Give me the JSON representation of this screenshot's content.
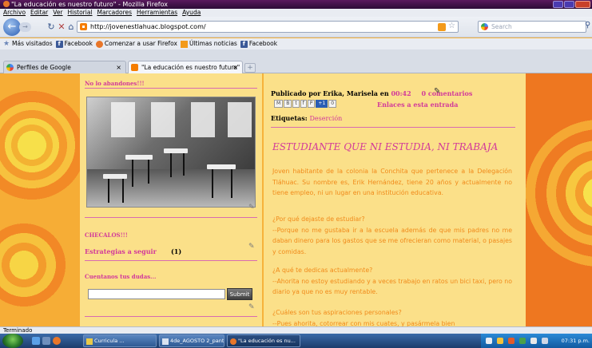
{
  "window": {
    "title": "\"La educación es nuestro futuro\" - Mozilla Firefox"
  },
  "menu": [
    "Archivo",
    "Editar",
    "Ver",
    "Historial",
    "Marcadores",
    "Herramientas",
    "Ayuda"
  ],
  "nav": {
    "url": "http://jovenestlahuac.blogspot.com/",
    "search_placeholder": "Search"
  },
  "bookmarks": [
    {
      "label": "Más visitados",
      "icon": "star-icon"
    },
    {
      "label": "Facebook",
      "icon": "facebook-icon"
    },
    {
      "label": "Comenzar a usar Firefox",
      "icon": "firefox-icon"
    },
    {
      "label": "Últimas noticias",
      "icon": "rss-icon"
    },
    {
      "label": "Facebook",
      "icon": "facebook-icon"
    }
  ],
  "tabs": [
    {
      "label": "Perfiles de Google",
      "active": false
    },
    {
      "label": "\"La educación es nuestro futuro\"",
      "active": true
    }
  ],
  "sidebar": {
    "widget1_title": "No lo abandones!!!",
    "widget2_title": "CHECALOS!!!",
    "strategies_link": "Estrategias a seguir",
    "strategies_count": "(1)",
    "widget3_title": "Cuentanos tus dudas...",
    "submit_label": "Submit"
  },
  "post": {
    "posted_by": "Publicado por Erika, Marisela en",
    "time": "00:42",
    "comments": "0 comentarios",
    "share_buttons": [
      "M",
      "B",
      "t",
      "f",
      "P",
      "+1",
      "0"
    ],
    "links_label": "Enlaces a esta entrada",
    "tags_label": "Etiquetas:",
    "tag": "Deserción",
    "title": "ESTUDIANTE QUE NI ESTUDIA, NI TRABAJA",
    "paragraphs": [
      "Joven habitante de la colonia la Conchita que pertenece a la Delegación Tláhuac. Su nombre es, Erik Hernández, tiene 20 años y actualmente no tiene empleo, ni un lugar en una institución educativa.",
      "¿Por qué dejaste de estudiar?\n--Porque no me gustaba ir a la escuela además de que mis padres no me daban dinero para los gastos que se me ofrecieran como material, o pasajes y comidas.",
      "¿A qué te dedicas actualmente?\n--Ahorita no estoy estudiando y a veces trabajo en ratos un bici taxi, pero no diario ya que no es muy rentable.",
      "¿Cuáles son tus aspiraciones personales?\n--Pues ahorita, cotorrear con mis cuates, y pasármela bien"
    ]
  },
  "status": {
    "text": "Terminado"
  },
  "taskbar": {
    "tasks": [
      {
        "label": "Curricula ..."
      },
      {
        "label": "4de_AGOSTO 2_pant..."
      },
      {
        "label": "\"La educación es nu..."
      }
    ],
    "clock": "07:31 p.m."
  },
  "colors": {
    "accent_pink": "#d23a9a",
    "post_orange": "#f08a1a",
    "content_bg": "#fbe089"
  }
}
